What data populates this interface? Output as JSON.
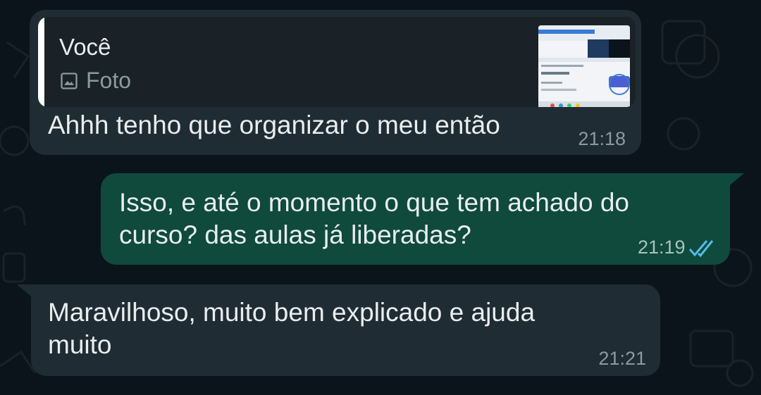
{
  "messages": [
    {
      "direction": "incoming",
      "reply": {
        "sender": "Você",
        "type_label": "Foto",
        "type_icon": "image-icon"
      },
      "text": "Ahhh tenho que organizar o meu então",
      "time": "21:18"
    },
    {
      "direction": "outgoing",
      "text_line1": "Isso, e até o momento o que tem achado do",
      "text_line2": "curso? das aulas já liberadas?",
      "time": "21:19",
      "status_icon": "double-check-icon",
      "status_color": "#53bdeb"
    },
    {
      "direction": "incoming",
      "text_line1": "Maravilhoso, muito bem explicado e ajuda",
      "text_line2": "muito",
      "time": "21:21"
    }
  ],
  "colors": {
    "background": "#0b141a",
    "incoming_bubble": "#1f2c34",
    "outgoing_bubble": "#0f4a3c",
    "read_receipt": "#53bdeb"
  }
}
